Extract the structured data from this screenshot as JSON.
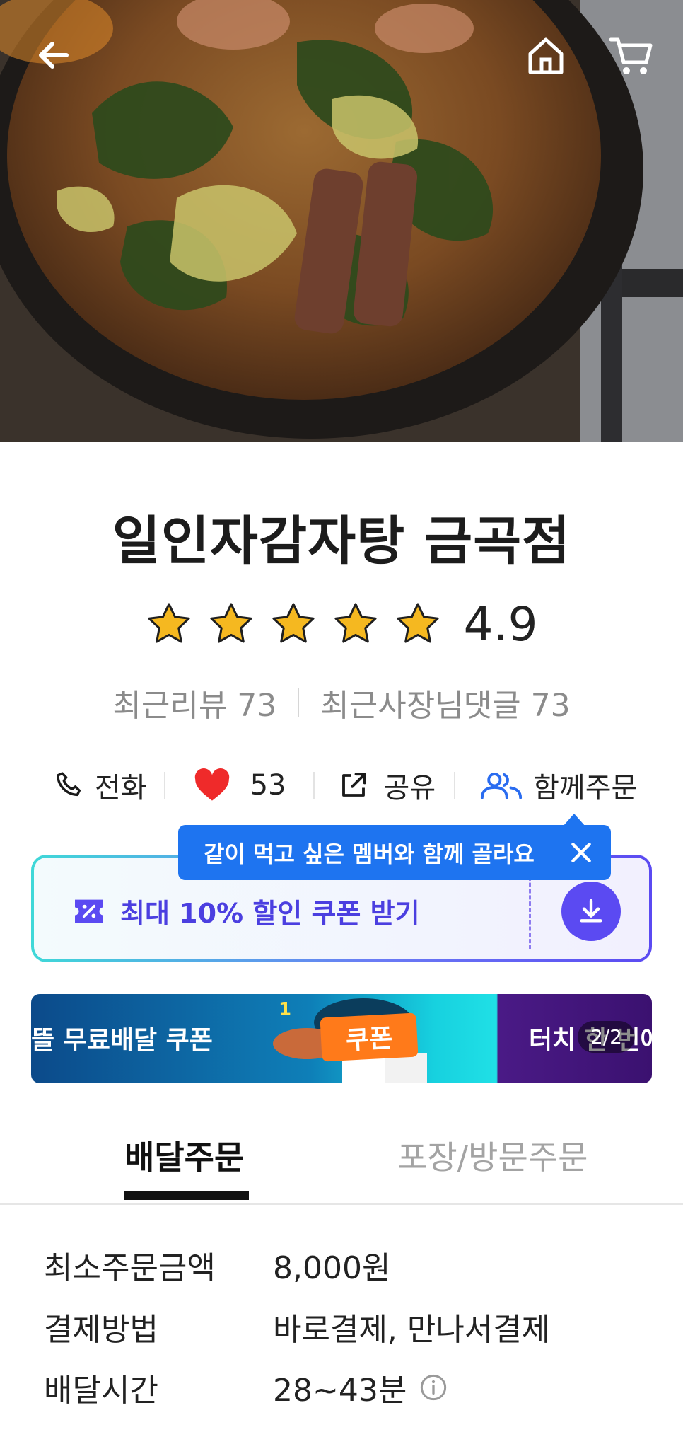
{
  "header": {
    "back_icon": "arrow-left-icon",
    "home_icon": "home-icon",
    "cart_icon": "cart-icon"
  },
  "store": {
    "name": "일인자감자탕 금곡점",
    "rating": "4.9",
    "stars": 5,
    "recent_reviews": "최근리뷰 73",
    "recent_owner_replies": "최근사장님댓글 73"
  },
  "actions": {
    "call": "전화",
    "likes": "53",
    "share": "공유",
    "group_order": "함께주문"
  },
  "tooltip": {
    "text": "같이 먹고 싶은 멤버와 함께 골라요"
  },
  "coupon": {
    "label": "최대 10% 할인 쿠폰 받기"
  },
  "banner": {
    "left_text": "뜰 무료배달 쿠폰",
    "tag": "쿠폰",
    "right_text": "터치 한 번에",
    "counter": "2/2"
  },
  "tabs": {
    "delivery": "배달주문",
    "pickup": "포장/방문주문",
    "active": "delivery"
  },
  "info": {
    "min_order_label": "최소주문금액",
    "min_order_value": "8,000원",
    "payment_label": "결제방법",
    "payment_value": "바로결제, 만나서결제",
    "delivery_time_label": "배달시간",
    "delivery_time_value": "28~43분"
  },
  "colors": {
    "accent_blue": "#1e74f0",
    "coupon_purple": "#5b4af2",
    "heart_red": "#ef2a2a",
    "star_gold": "#f5b820"
  }
}
